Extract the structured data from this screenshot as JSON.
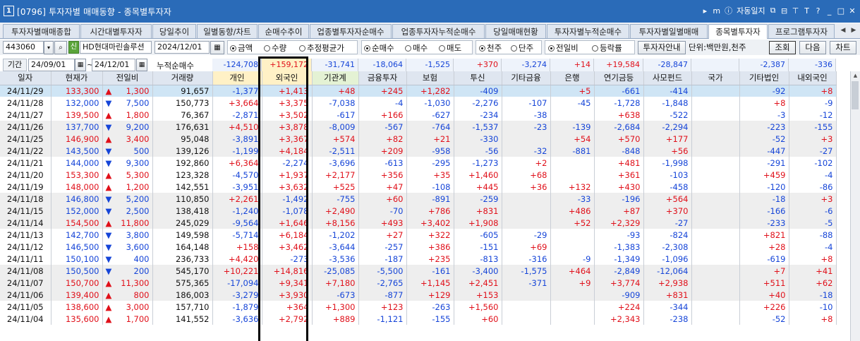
{
  "window": {
    "number": "1",
    "title": "[0796] 투자자별 매매동향 - 종목별투자자",
    "controls": [
      "▸",
      "m",
      "ⓘ",
      "자동일지",
      "⧉",
      "⊟",
      "⊤",
      "T",
      "?",
      "_",
      "□",
      "✕"
    ]
  },
  "tabs": [
    {
      "label": "투자자별매매종합",
      "active": false
    },
    {
      "label": "시간대별투자자",
      "active": false
    },
    {
      "label": "당일추이",
      "active": false
    },
    {
      "label": "일별동향/차트",
      "active": false
    },
    {
      "label": "순매수추이",
      "active": false
    },
    {
      "label": "업종별투자자순매수",
      "active": false
    },
    {
      "label": "업종투자자누적순매수",
      "active": false
    },
    {
      "label": "당일매매현황",
      "active": false
    },
    {
      "label": "투자자별누적순매수",
      "active": false
    },
    {
      "label": "투자자별일별매매",
      "active": false
    },
    {
      "label": "종목별투자자",
      "active": true
    },
    {
      "label": "프로그램투자자",
      "active": false
    }
  ],
  "toolbar": {
    "code": "443060",
    "badge": "신",
    "stock_name": "HD현대마린솔루션",
    "date": "2024/12/01",
    "unit_radios": [
      {
        "label": "금액",
        "on": true
      },
      {
        "label": "수량",
        "on": false
      },
      {
        "label": "추정평균가",
        "on": false
      }
    ],
    "trade_radios": [
      {
        "label": "순매수",
        "on": true
      },
      {
        "label": "매수",
        "on": false
      },
      {
        "label": "매도",
        "on": false
      }
    ],
    "share_radios": [
      {
        "label": "천주",
        "on": true
      },
      {
        "label": "단주",
        "on": false
      }
    ],
    "compare_radios": [
      {
        "label": "전일비",
        "on": true
      },
      {
        "label": "등락률",
        "on": false
      }
    ],
    "guide_button": "투자자안내",
    "unit_text": "단위:백만원,천주",
    "query_button": "조회",
    "next_button": "다음",
    "chart_button": "차트"
  },
  "period": {
    "label": "기간",
    "from": "24/09/01",
    "sep": "~",
    "to": "24/12/01",
    "cum_label": "누적순매수",
    "cum_values": [
      {
        "v": "-124,708",
        "cls": "dn"
      },
      {
        "v": "+159,172",
        "cls": "up"
      },
      {
        "v": "-31,741",
        "cls": "dn"
      },
      {
        "v": "-18,064",
        "cls": "dn"
      },
      {
        "v": "-1,525",
        "cls": "dn"
      },
      {
        "v": "+370",
        "cls": "up"
      },
      {
        "v": "-3,274",
        "cls": "dn"
      },
      {
        "v": "+14",
        "cls": "up"
      },
      {
        "v": "+19,584",
        "cls": "up"
      },
      {
        "v": "-28,847",
        "cls": "dn"
      },
      {
        "v": "",
        "cls": "nt"
      },
      {
        "v": "-2,387",
        "cls": "dn"
      },
      {
        "v": "-336",
        "cls": "dn"
      }
    ]
  },
  "columns": [
    "일자",
    "현재가",
    "전일비",
    "거래량",
    "개인",
    "외국인",
    "기관계",
    "금융투자",
    "보험",
    "투신",
    "기타금융",
    "은행",
    "연기금등",
    "사모펀드",
    "국가",
    "기타법인",
    "내외국인"
  ],
  "rows": [
    [
      "24/11/29",
      "133,300",
      "▲",
      "1,300",
      "91,657",
      "-1,377",
      "+1,413",
      "+48",
      "+245",
      "+1,282",
      "-409",
      "",
      "+5",
      "-661",
      "-414",
      "",
      "-92",
      "+8"
    ],
    [
      "24/11/28",
      "132,000",
      "▼",
      "7,500",
      "150,773",
      "+3,664",
      "+3,375",
      "-7,038",
      "-4",
      "-1,030",
      "-2,276",
      "-107",
      "-45",
      "-1,728",
      "-1,848",
      "",
      "+8",
      "-9"
    ],
    [
      "24/11/27",
      "139,500",
      "▲",
      "1,800",
      "76,367",
      "-2,871",
      "+3,502",
      "-617",
      "+166",
      "-627",
      "-234",
      "-38",
      "",
      "+638",
      "-522",
      "",
      "-3",
      "-12"
    ],
    [
      "24/11/26",
      "137,700",
      "▼",
      "9,200",
      "176,631",
      "+4,510",
      "+3,878",
      "-8,009",
      "-567",
      "-764",
      "-1,537",
      "-23",
      "-139",
      "-2,684",
      "-2,294",
      "",
      "-223",
      "-155"
    ],
    [
      "24/11/25",
      "146,900",
      "▲",
      "3,400",
      "95,048",
      "-3,891",
      "+3,367",
      "+574",
      "+82",
      "+21",
      "-330",
      "",
      "+54",
      "+570",
      "+177",
      "",
      "-52",
      "+3"
    ],
    [
      "24/11/22",
      "143,500",
      "▼",
      "500",
      "139,126",
      "-1,199",
      "+4,184",
      "-2,511",
      "+209",
      "-958",
      "-56",
      "-32",
      "-881",
      "-848",
      "+56",
      "",
      "-447",
      "-27"
    ],
    [
      "24/11/21",
      "144,000",
      "▼",
      "9,300",
      "192,860",
      "+6,364",
      "-2,274",
      "-3,696",
      "-613",
      "-295",
      "-1,273",
      "+2",
      "",
      "+481",
      "-1,998",
      "",
      "-291",
      "-102"
    ],
    [
      "24/11/20",
      "153,300",
      "▲",
      "5,300",
      "123,328",
      "-4,570",
      "+1,937",
      "+2,177",
      "+356",
      "+35",
      "+1,460",
      "+68",
      "",
      "+361",
      "-103",
      "",
      "+459",
      "-4"
    ],
    [
      "24/11/19",
      "148,000",
      "▲",
      "1,200",
      "142,551",
      "-3,951",
      "+3,632",
      "+525",
      "+47",
      "-108",
      "+445",
      "+36",
      "+132",
      "+430",
      "-458",
      "",
      "-120",
      "-86"
    ],
    [
      "24/11/18",
      "146,800",
      "▼",
      "5,200",
      "110,850",
      "+2,261",
      "-1,492",
      "-755",
      "+60",
      "-891",
      "-259",
      "",
      "-33",
      "-196",
      "+564",
      "",
      "-18",
      "+3"
    ],
    [
      "24/11/15",
      "152,000",
      "▼",
      "2,500",
      "138,418",
      "-1,240",
      "-1,078",
      "+2,490",
      "-70",
      "+786",
      "+831",
      "",
      "+486",
      "+87",
      "+370",
      "",
      "-166",
      "-6"
    ],
    [
      "24/11/14",
      "154,500",
      "▲",
      "11,800",
      "245,029",
      "-9,564",
      "+1,646",
      "+8,156",
      "+493",
      "+3,402",
      "+1,908",
      "",
      "+52",
      "+2,329",
      "-27",
      "",
      "-233",
      "-5"
    ],
    [
      "24/11/13",
      "142,700",
      "▼",
      "3,800",
      "149,598",
      "-5,714",
      "+6,184",
      "-1,202",
      "+27",
      "+322",
      "-605",
      "-29",
      "",
      "-93",
      "-824",
      "",
      "+821",
      "-88"
    ],
    [
      "24/11/12",
      "146,500",
      "▼",
      "3,600",
      "164,148",
      "+158",
      "+3,462",
      "-3,644",
      "-257",
      "+386",
      "-151",
      "+69",
      "",
      "-1,383",
      "-2,308",
      "",
      "+28",
      "-4"
    ],
    [
      "24/11/11",
      "150,100",
      "▼",
      "400",
      "236,733",
      "+4,420",
      "-273",
      "-3,536",
      "-187",
      "+235",
      "-813",
      "-316",
      "-9",
      "-1,349",
      "-1,096",
      "",
      "-619",
      "+8"
    ],
    [
      "24/11/08",
      "150,500",
      "▼",
      "200",
      "545,170",
      "+10,221",
      "+14,816",
      "-25,085",
      "-5,500",
      "-161",
      "-3,400",
      "-1,575",
      "+464",
      "-2,849",
      "-12,064",
      "",
      "+7",
      "+41"
    ],
    [
      "24/11/07",
      "150,700",
      "▲",
      "11,300",
      "575,365",
      "-17,094",
      "+9,341",
      "+7,180",
      "-2,765",
      "+1,145",
      "+2,451",
      "-371",
      "+9",
      "+3,774",
      "+2,938",
      "",
      "+511",
      "+62"
    ],
    [
      "24/11/06",
      "139,400",
      "▲",
      "800",
      "186,003",
      "-3,279",
      "+3,930",
      "-673",
      "-877",
      "+129",
      "+153",
      "",
      "",
      "-909",
      "+831",
      "",
      "+40",
      "-18"
    ],
    [
      "24/11/05",
      "138,600",
      "▲",
      "3,000",
      "157,710",
      "-1,879",
      "+364",
      "+1,300",
      "+123",
      "-263",
      "+1,560",
      "",
      "",
      "+224",
      "-344",
      "",
      "+226",
      "-10"
    ],
    [
      "24/11/04",
      "135,600",
      "▲",
      "1,700",
      "141,552",
      "-3,636",
      "+2,792",
      "+889",
      "-1,121",
      "-155",
      "+60",
      "",
      "",
      "+2,343",
      "-238",
      "",
      "-52",
      "+8"
    ]
  ],
  "colors": {
    "up": "#e0101a",
    "down": "#1645d8",
    "title_bar": "#2a6bb8",
    "highlight_frame": "#000000"
  }
}
